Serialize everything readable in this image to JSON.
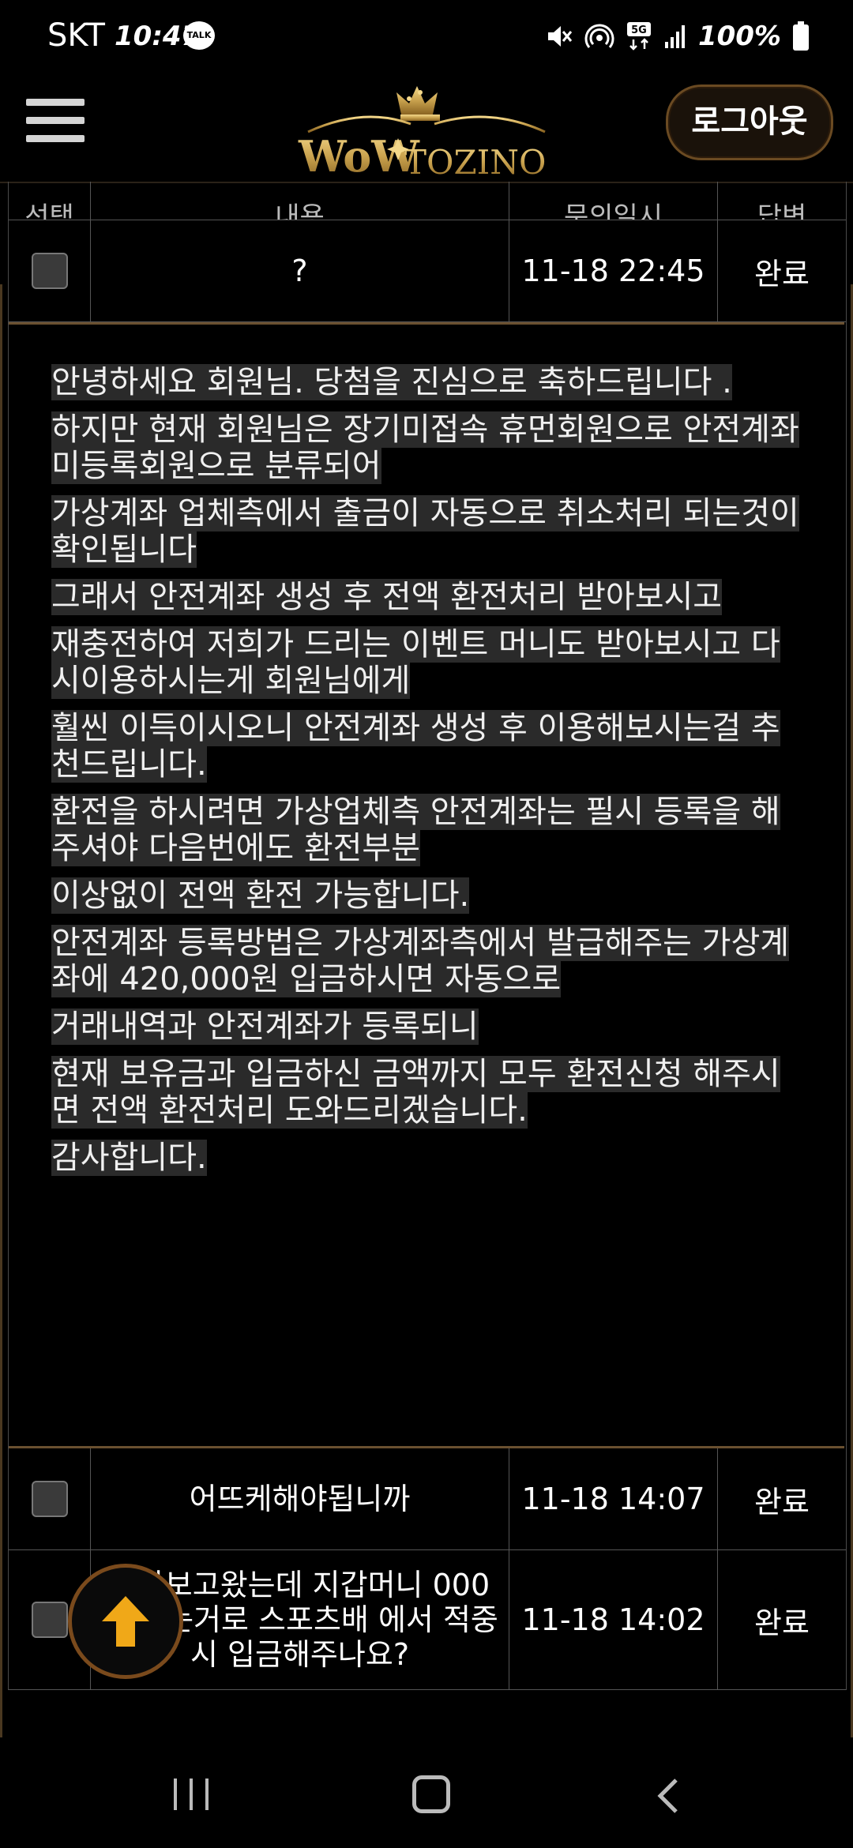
{
  "status": {
    "carrier": "SKT",
    "time": "10:47",
    "talk_badge": "TALK",
    "battery": "100%",
    "network": "5G"
  },
  "header": {
    "logo_text_1": "WoW",
    "logo_text_2": "TOZINO",
    "logout_label": "로그아웃"
  },
  "table": {
    "columns": [
      "선택",
      "내용",
      "문의일시",
      "답변"
    ],
    "rows": [
      {
        "content": "?",
        "date": "11-18 22:45",
        "status": "완료"
      },
      {
        "content": "어뜨케해야됩니까",
        "date": "11-18 14:07",
        "status": "완료"
      },
      {
        "content": "문자보고왔는데 지갑머니 000원 있는거로 스포츠배 에서 적중시 입금해주나요?",
        "date": "11-18 14:02",
        "status": "완료"
      }
    ]
  },
  "answer": {
    "lines": [
      "안녕하세요 회원님. 당첨을 진심으로 축하드립니다 .",
      "하지만 현재 회원님은 장기미접속 휴먼회원으로 안전계좌 미등록회원으로 분류되어",
      "가상계좌 업체측에서 출금이 자동으로 취소처리 되는것이 확인됩니다",
      "그래서 안전계좌 생성 후 전액 환전처리 받아보시고",
      "재충전하여 저희가 드리는 이벤트 머니도 받아보시고 다시이용하시는게 회원님에게",
      "훨씬 이득이시오니 안전계좌 생성 후 이용해보시는걸 추천드립니다.",
      "환전을 하시려면 가상업체측 안전계좌는 필시 등록을 해주셔야 다음번에도 환전부분",
      "이상없이 전액 환전 가능합니다.",
      "안전계좌 등록방법은 가상계좌측에서 발급해주는 가상계좌에 420,000원 입금하시면 자동으로",
      "거래내역과 안전계좌가 등록되니",
      "현재 보유금과 입금하신 금액까지 모두 환전신청 해주시면 전액 환전처리 도와드리겠습니다.",
      "감사합니다."
    ]
  },
  "colors": {
    "accent_gold": "#c9a24e",
    "scroll_arrow": "#f0a818",
    "border_brown": "#6a5030"
  }
}
